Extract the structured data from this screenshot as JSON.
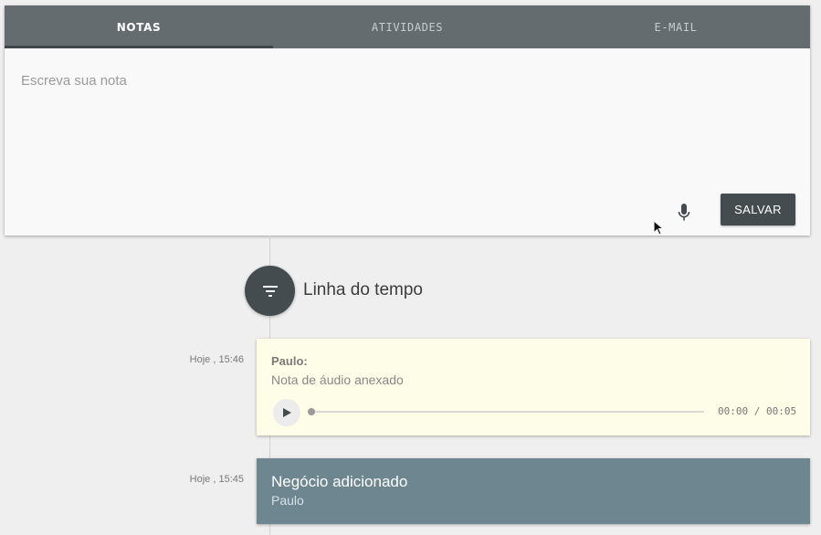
{
  "tabs": [
    {
      "label": "NOTAS",
      "active": true
    },
    {
      "label": "ATIVIDADES",
      "active": false
    },
    {
      "label": "E-MAIL",
      "active": false
    }
  ],
  "note_editor": {
    "placeholder": "Escreva sua nota",
    "mic_icon": "microphone-icon",
    "save_label": "SALVAR"
  },
  "timeline": {
    "title": "Linha do tempo",
    "filter_icon": "filter-icon",
    "entries": [
      {
        "time": "Hoje , 15:46",
        "author": "Paulo:",
        "description": "Nota de áudio anexado",
        "audio": {
          "play_icon": "play-icon",
          "time": "00:00 / 00:05"
        }
      },
      {
        "time": "Hoje , 15:45",
        "title": "Negócio adicionado",
        "subtitle": "Paulo"
      }
    ]
  },
  "colors": {
    "tab_bar": "#646c70",
    "primary_dark": "#454c50",
    "audio_card_bg": "#fefde7",
    "deal_card_bg": "#6d8690"
  }
}
